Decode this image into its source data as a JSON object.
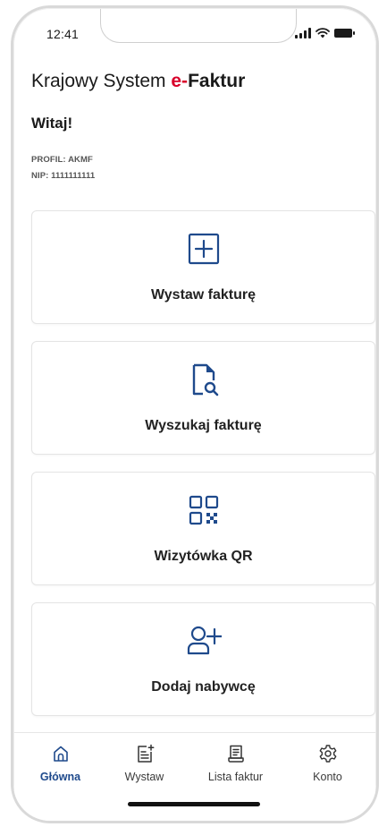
{
  "status_bar": {
    "time": "12:41"
  },
  "header": {
    "title_prefix": "Krajowy System ",
    "title_accent": "e-",
    "title_bold": "Faktur",
    "greeting": "Witaj!",
    "profile": "PROFIL: AKMF",
    "nip": "NIP: 1111111111"
  },
  "cards": [
    {
      "label": "Wystaw fakturę",
      "icon": "plus-square-icon"
    },
    {
      "label": "Wyszukaj fakturę",
      "icon": "search-document-icon"
    },
    {
      "label": "Wizytówka QR",
      "icon": "qr-code-icon"
    },
    {
      "label": "Dodaj nabywcę",
      "icon": "add-user-icon"
    }
  ],
  "bottom_nav": {
    "active": "Główna",
    "items": [
      {
        "label": "Główna",
        "icon": "home-icon"
      },
      {
        "label": "Wystaw",
        "icon": "new-document-icon"
      },
      {
        "label": "Lista faktur",
        "icon": "invoice-list-icon"
      },
      {
        "label": "Konto",
        "icon": "gear-icon"
      }
    ]
  },
  "colors": {
    "accent_red": "#d8002a",
    "icon_blue": "#1f4a8c",
    "text": "#1a1a1a",
    "border": "#e4e4e4"
  }
}
